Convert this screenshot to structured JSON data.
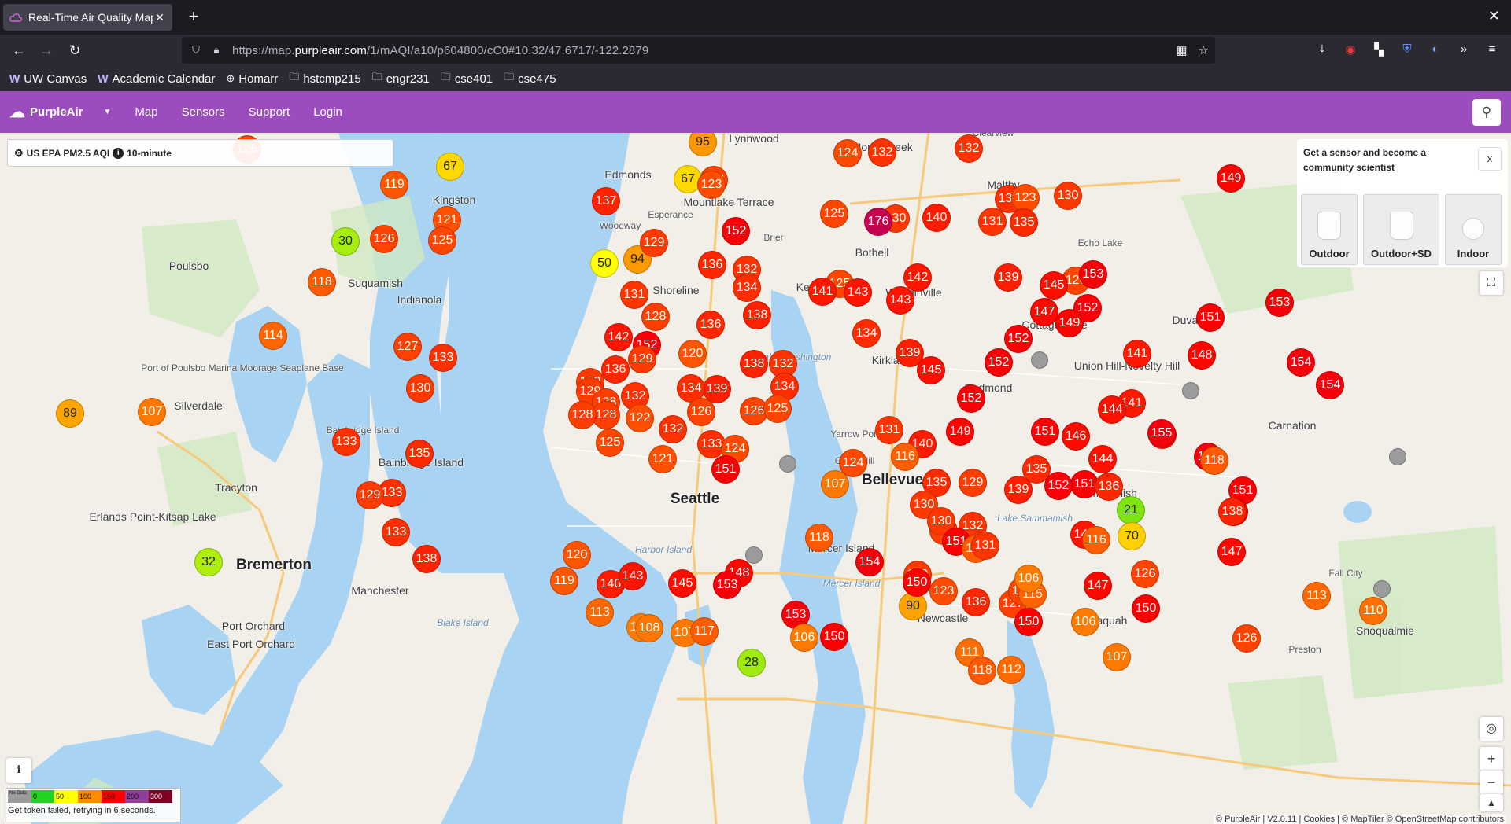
{
  "browser": {
    "tab_title": "Real-Time Air Quality Map",
    "url_prefix": "https://map.",
    "url_domain": "purpleair.com",
    "url_rest": "/1/mAQI/a10/p604800/cC0#10.32/47.6717/-122.2879",
    "bookmarks": [
      "UW Canvas",
      "Academic Calendar",
      "Homarr",
      "hstcmp215",
      "engr231",
      "cse401",
      "cse475"
    ]
  },
  "header": {
    "brand": "PurpleAir",
    "menu": [
      "Map",
      "Sensors",
      "Support",
      "Login"
    ]
  },
  "aqi_panel": {
    "label": "US EPA PM2.5 AQI",
    "period": "10-minute"
  },
  "promo": {
    "title": "Get a sensor and become a community scientist",
    "close": "x",
    "products": [
      "Outdoor",
      "Outdoor+SD",
      "Indoor"
    ]
  },
  "legend": {
    "scale": [
      "No Data",
      "0",
      "50",
      "100",
      "150",
      "200",
      "300"
    ],
    "colors": [
      "#9b9b9b",
      "#24d121",
      "#ffff00",
      "#ff8c00",
      "#ff0000",
      "#8f3f97",
      "#7e0023"
    ],
    "status": "Get token failed, retrying in 6 seconds."
  },
  "attribution": "© PurpleAir | V2.0.11 | Cookies | © MapTiler © OpenStreetMap contributors",
  "map": {
    "places": [
      {
        "t": "Lynnwood"
      },
      {
        "t": "North Creek"
      },
      {
        "t": "Clearview"
      },
      {
        "t": "Edmonds"
      },
      {
        "t": "Kingston"
      },
      {
        "t": "Esperance"
      },
      {
        "t": "Mountlake Terrace"
      },
      {
        "t": "Maltby"
      },
      {
        "t": "Woodway"
      },
      {
        "t": "Brier"
      },
      {
        "t": "Echo Lake"
      },
      {
        "t": "Indianola"
      },
      {
        "t": "Shoreline"
      },
      {
        "t": "Kenmore"
      },
      {
        "t": "Bothell"
      },
      {
        "t": "Woodinville"
      },
      {
        "t": "Poulsbo"
      },
      {
        "t": "Suquamish"
      },
      {
        "t": "Duvall"
      },
      {
        "t": "Cottage Lake"
      },
      {
        "t": "Port of Poulsbo Marina Moorage Seaplane Base"
      },
      {
        "t": "Lake Washington"
      },
      {
        "t": "Kirkland"
      },
      {
        "t": "Union Hill-Novelty Hill"
      },
      {
        "t": "Redmond"
      },
      {
        "t": "Silverdale"
      },
      {
        "t": "Bainbridge Island"
      },
      {
        "t": "Carnation"
      },
      {
        "t": "Yarrow Point"
      },
      {
        "t": "Clyde Hill"
      },
      {
        "t": "Bellevue"
      },
      {
        "t": "Tracyton"
      },
      {
        "t": "Sammamish"
      },
      {
        "t": "Seattle"
      },
      {
        "t": "Erlands Point-Kitsap Lake"
      },
      {
        "t": "Lake Sammamish"
      },
      {
        "t": "Mercer Island"
      },
      {
        "t": "Harbor Island"
      },
      {
        "t": "Bremerton"
      },
      {
        "t": "Manchester"
      },
      {
        "t": "Fall City"
      },
      {
        "t": "Newcastle"
      },
      {
        "t": "Issaquah"
      },
      {
        "t": "Port Orchard"
      },
      {
        "t": "Blake Island"
      },
      {
        "t": "Snoqualmie"
      },
      {
        "t": "East Port Orchard"
      },
      {
        "t": "Preston"
      },
      {
        "t": "Bainbridge Island"
      },
      {
        "t": "Mercer Island"
      }
    ],
    "sensors": [
      126,
      95,
      124,
      132,
      67,
      119,
      137,
      126,
      67,
      123,
      125,
      132,
      130,
      149,
      121,
      130,
      125,
      133,
      123,
      131,
      135,
      50,
      94,
      176,
      140,
      30,
      126,
      129,
      152,
      125,
      126,
      136,
      152,
      118,
      132,
      153,
      131,
      134,
      141,
      143,
      143,
      142,
      139,
      145,
      138,
      128,
      136,
      134,
      147,
      152,
      149,
      151,
      153,
      114,
      127,
      133,
      142,
      152,
      120,
      139,
      141,
      148,
      152,
      136,
      129,
      129,
      138,
      132,
      145,
      154,
      154,
      126,
      129,
      139,
      134,
      128,
      134,
      130,
      128,
      132,
      125,
      126,
      131,
      122,
      132,
      152,
      89,
      107,
      133,
      135,
      128,
      125,
      121,
      133,
      140,
      149,
      151,
      146,
      141,
      144,
      124,
      146,
      151,
      135,
      144,
      155,
      155,
      118,
      133,
      129,
      124,
      151,
      107,
      135,
      130,
      129,
      139,
      136,
      151,
      148,
      116,
      128,
      130,
      132,
      142,
      152,
      147,
      138,
      152,
      151,
      118,
      21,
      70,
      116,
      117,
      133,
      131,
      120,
      138,
      154,
      129,
      90,
      127,
      126,
      115,
      106,
      32,
      119,
      140,
      143,
      145,
      153,
      150,
      123,
      136,
      126,
      150,
      113,
      105,
      108,
      107,
      117,
      153,
      150,
      28,
      106,
      111,
      147,
      150,
      126,
      113,
      110,
      106,
      107,
      112,
      118,
      138,
      135
    ]
  }
}
